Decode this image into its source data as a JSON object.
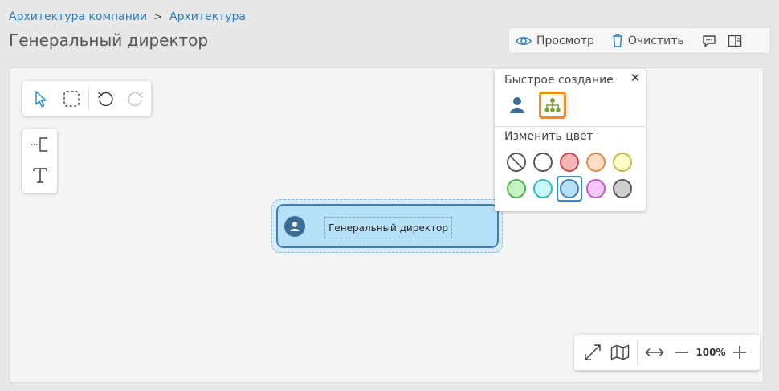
{
  "breadcrumb": {
    "items": [
      "Архитектура компании",
      "Архитектура"
    ],
    "separator": ">"
  },
  "page": {
    "title": "Генеральный директор"
  },
  "toolbar": {
    "view_label": "Просмотр",
    "clear_label": "Очистить",
    "icons": [
      "eye-icon",
      "trash-icon",
      "comment-icon",
      "side-panel-icon"
    ]
  },
  "canvas_tools": {
    "select": "pointer-icon",
    "area_select": "dashed-rect-icon",
    "undo": "undo-icon",
    "redo": "redo-icon",
    "connector": "connector-icon",
    "text": "text-icon"
  },
  "node": {
    "label": "Генеральный директор",
    "icon": "person-icon",
    "fill_color": "#b6dff8",
    "border_color": "#3e7fb5"
  },
  "popup": {
    "quick_create_title": "Быстрое создание",
    "change_color_title": "Изменить цвет",
    "close_symbol": "✕",
    "quick_create_items": [
      "person-icon",
      "org-chart-icon"
    ],
    "active_quick_create": "org-chart-icon",
    "colors": [
      {
        "name": "none",
        "fill": "#ffffff",
        "border": "#555555"
      },
      {
        "name": "white",
        "fill": "#ffffff",
        "border": "#555555"
      },
      {
        "name": "red",
        "fill": "#f7b4b4",
        "border": "#c9464e"
      },
      {
        "name": "orange",
        "fill": "#fbdcc4",
        "border": "#d98d4f"
      },
      {
        "name": "yellow",
        "fill": "#fdfbc6",
        "border": "#c2b84a"
      },
      {
        "name": "green",
        "fill": "#c7f3c2",
        "border": "#4fad52"
      },
      {
        "name": "cyan",
        "fill": "#c7f7f7",
        "border": "#33b6b6"
      },
      {
        "name": "blue",
        "fill": "#b6dff8",
        "border": "#3e7fb5"
      },
      {
        "name": "magenta",
        "fill": "#f6c6f6",
        "border": "#b65cc2"
      },
      {
        "name": "gray",
        "fill": "#cfcfcf",
        "border": "#555555"
      }
    ],
    "selected_color": "blue"
  },
  "zoom": {
    "value": "100%",
    "icons": [
      "fullscreen-icon",
      "map-icon",
      "fit-width-icon",
      "zoom-out-icon",
      "zoom-in-icon"
    ]
  }
}
